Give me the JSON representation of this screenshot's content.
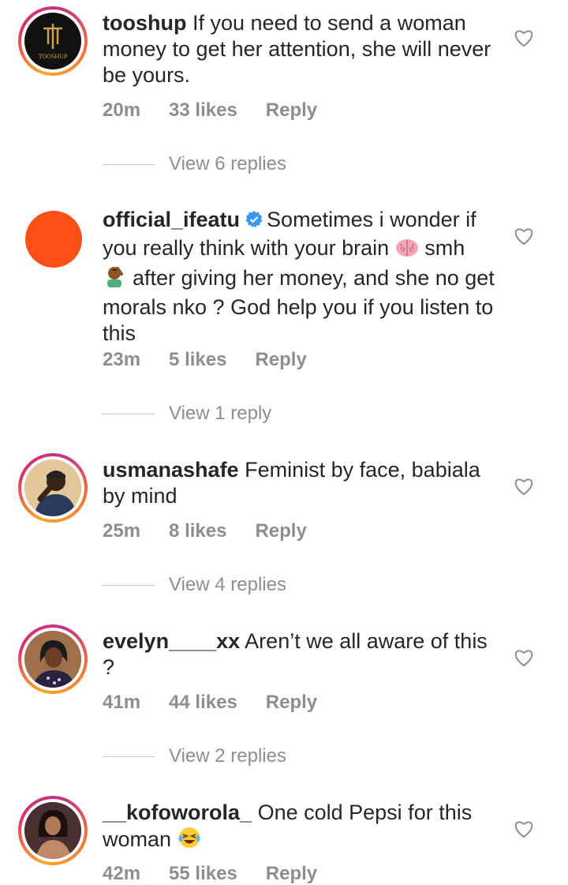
{
  "comments": [
    {
      "username": "tooshup",
      "text": "If you need to send a woman money to get her attention, she will never be yours.",
      "avatar_label": "TOOSHUP",
      "time": "20m",
      "likes": "33 likes",
      "reply": "Reply",
      "view_replies": "View 6 replies"
    },
    {
      "username": "official_ifeatu",
      "text_parts": [
        "Sometimes i wonder if you really think with your brain",
        "smh",
        "after giving her money, and she no get morals nko ? God help you if you listen to this"
      ],
      "verified": true,
      "time": "23m",
      "likes": "5 likes",
      "reply": "Reply",
      "view_replies": "View 1 reply"
    },
    {
      "username": "usmanashafe",
      "text": "Feminist by face, babiala by mind",
      "time": "25m",
      "likes": "8 likes",
      "reply": "Reply",
      "view_replies": "View 4 replies"
    },
    {
      "username": "evelyn____xx",
      "text": "Aren’t we all aware of this ?",
      "time": "41m",
      "likes": "44 likes",
      "reply": "Reply",
      "view_replies": "View 2 replies"
    },
    {
      "username": "__kofoworola_",
      "text": "One cold Pepsi for this woman",
      "time": "42m",
      "likes": "55 likes",
      "reply": "Reply"
    }
  ],
  "colors": {
    "text": "#262626",
    "meta": "#8e8e8e",
    "verified": "#3897f0",
    "ifeatu_avatar": "#fe5016"
  }
}
